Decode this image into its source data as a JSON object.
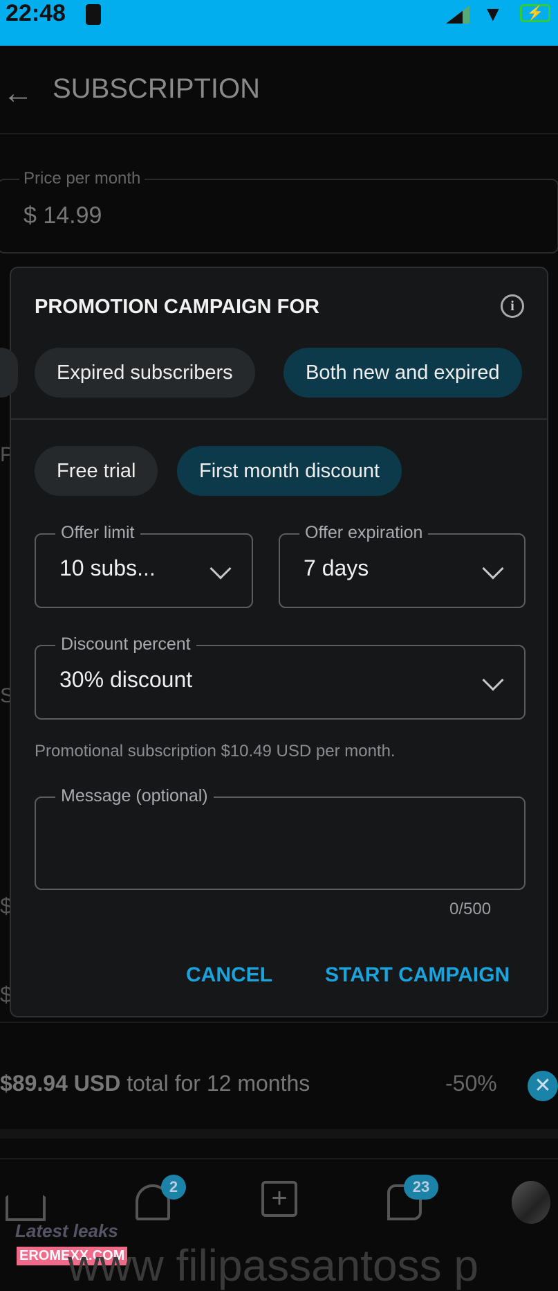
{
  "status_bar": {
    "time": "22:48",
    "color": "#03aeef"
  },
  "header": {
    "title": "SUBSCRIPTION",
    "back_icon": "arrow-left-icon"
  },
  "price_field": {
    "label": "Price per month",
    "value": "$ 14.99"
  },
  "background_rows": {
    "bundle_text_bold": "$89.94 USD",
    "bundle_text": "total for 12 months",
    "bundle_discount": "-50%"
  },
  "dialog": {
    "title": "PROMOTION CAMPAIGN FOR",
    "audience_chips": [
      {
        "label": "Expired subscribers",
        "selected": false
      },
      {
        "label": "Both new and expired",
        "selected": true
      }
    ],
    "type_chips": [
      {
        "label": "Free trial",
        "selected": false
      },
      {
        "label": "First month discount",
        "selected": true
      }
    ],
    "offer_limit": {
      "label": "Offer limit",
      "value": "10 subs..."
    },
    "offer_expiration": {
      "label": "Offer expiration",
      "value": "7 days"
    },
    "discount_percent": {
      "label": "Discount percent",
      "value": "30% discount"
    },
    "helper_text": "Promotional subscription $10.49 USD per month.",
    "message": {
      "label": "Message (optional)",
      "value": "",
      "counter": "0/500"
    },
    "cancel_label": "CANCEL",
    "start_label": "START CAMPAIGN",
    "accent": "#1aa3dc"
  },
  "bottom_nav": {
    "notifications_badge": "2",
    "messages_badge": "23"
  },
  "watermark": {
    "line1": "Latest leaks",
    "line2": "EROMEXX.COM",
    "url": "www filipassantoss p"
  }
}
